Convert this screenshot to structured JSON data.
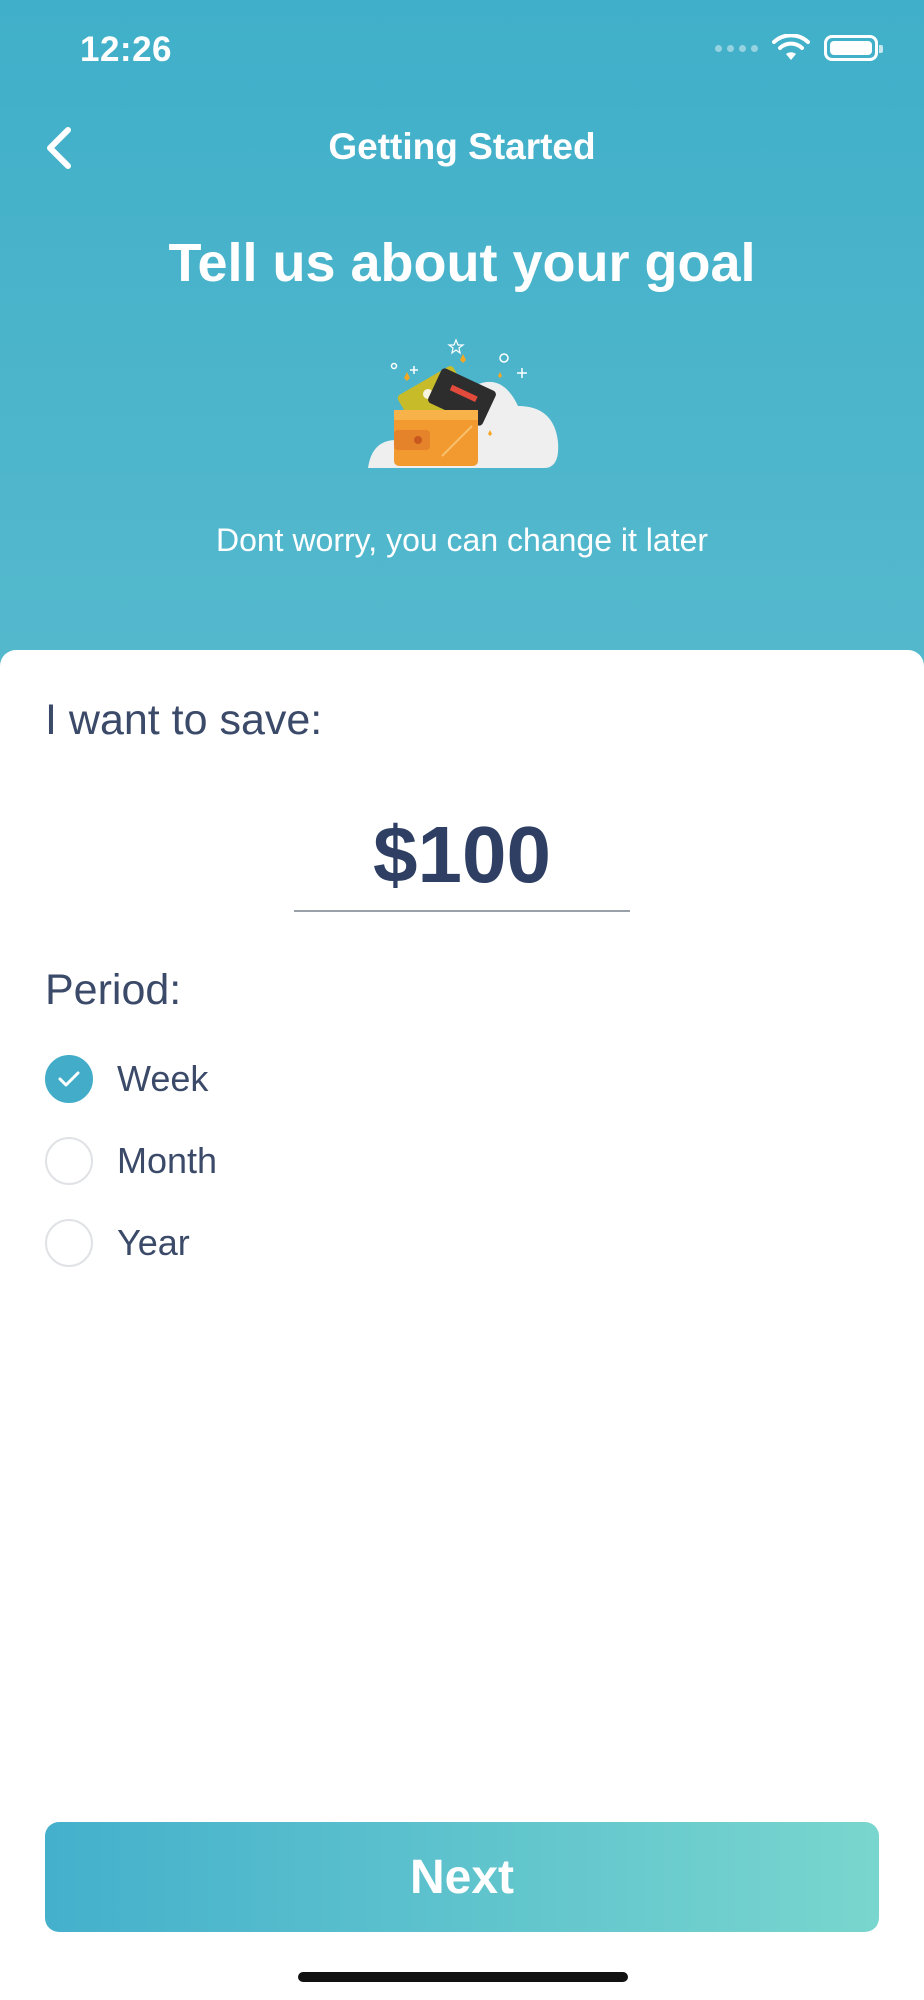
{
  "status_bar": {
    "time": "12:26"
  },
  "nav": {
    "title": "Getting Started",
    "back_icon": "chevron-left-icon"
  },
  "hero": {
    "title": "Tell us about your goal",
    "illustration_icon": "wallet-cards-cloud-illustration",
    "subtitle": "Dont worry, you can change it later"
  },
  "form": {
    "save_label": "I want to save:",
    "amount_value": "$100",
    "period_label": "Period:",
    "period_options": [
      {
        "label": "Week",
        "selected": true
      },
      {
        "label": "Month",
        "selected": false
      },
      {
        "label": "Year",
        "selected": false
      }
    ]
  },
  "footer": {
    "next_label": "Next"
  },
  "colors": {
    "header_top": "#40afc9",
    "header_bottom": "#55b9cd",
    "accent": "#43adc9",
    "text_primary": "#2e3f63",
    "button_gradient_start": "#44b0cc",
    "button_gradient_end": "#79d6ce"
  }
}
